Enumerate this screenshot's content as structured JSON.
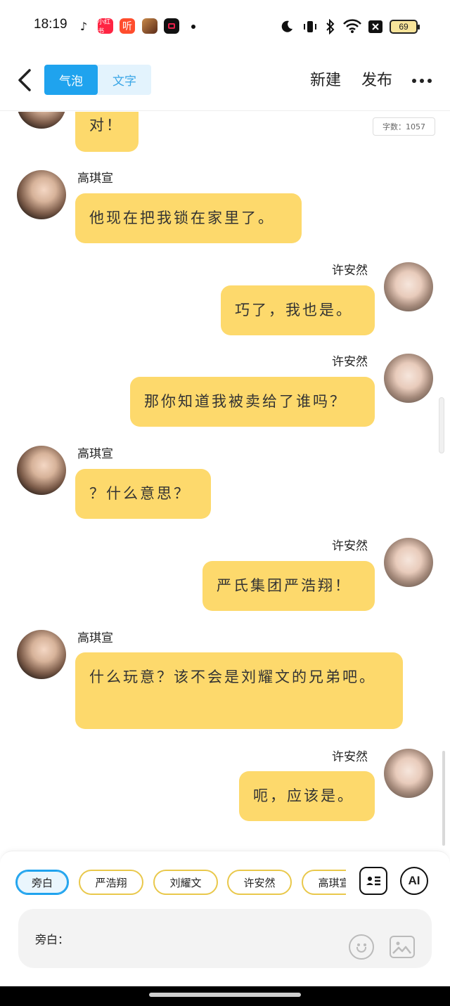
{
  "status_bar": {
    "time": "18:19",
    "app_icons": [
      {
        "name": "douyin-icon",
        "label": "",
        "color": "#111111"
      },
      {
        "name": "xiaohongshu-icon",
        "label": "小红书",
        "color": "#ff2442"
      },
      {
        "name": "ting-icon",
        "label": "听",
        "color": "#ff4d2d"
      },
      {
        "name": "game-icon",
        "label": "",
        "color": "#8a4b2a"
      },
      {
        "name": "video-record-icon",
        "label": "",
        "color": "#e8204a"
      }
    ],
    "battery": "69"
  },
  "header": {
    "tabs": [
      {
        "label": "气泡",
        "active": true
      },
      {
        "label": "文字",
        "active": false
      }
    ],
    "new_label": "新建",
    "publish_label": "发布"
  },
  "chat": {
    "word_count": "字数：1057",
    "messages": [
      {
        "side": "left",
        "name": "",
        "text": "对！"
      },
      {
        "side": "left",
        "name": "高琪宣",
        "text": "他现在把我锁在家里了。"
      },
      {
        "side": "right",
        "name": "许安然",
        "text": "巧了，我也是。"
      },
      {
        "side": "right",
        "name": "许安然",
        "text": "那你知道我被卖给了谁吗？"
      },
      {
        "side": "left",
        "name": "高琪宣",
        "text": "？什么意思？"
      },
      {
        "side": "right",
        "name": "许安然",
        "text": "严氏集团严浩翔！"
      },
      {
        "side": "left",
        "name": "高琪宣",
        "text": "什么玩意？该不会是刘耀文的兄弟吧。"
      },
      {
        "side": "right",
        "name": "许安然",
        "text": "呃，应该是。"
      }
    ]
  },
  "roles": [
    "旁白",
    "严浩翔",
    "刘耀文",
    "许安然",
    "高琪宣"
  ],
  "tools": {
    "ai_label": "AI"
  },
  "input": {
    "label": "旁白："
  },
  "colors": {
    "bubble": "#fdd96c",
    "accent": "#1fa3ee",
    "chip_border": "#e9c84b"
  }
}
